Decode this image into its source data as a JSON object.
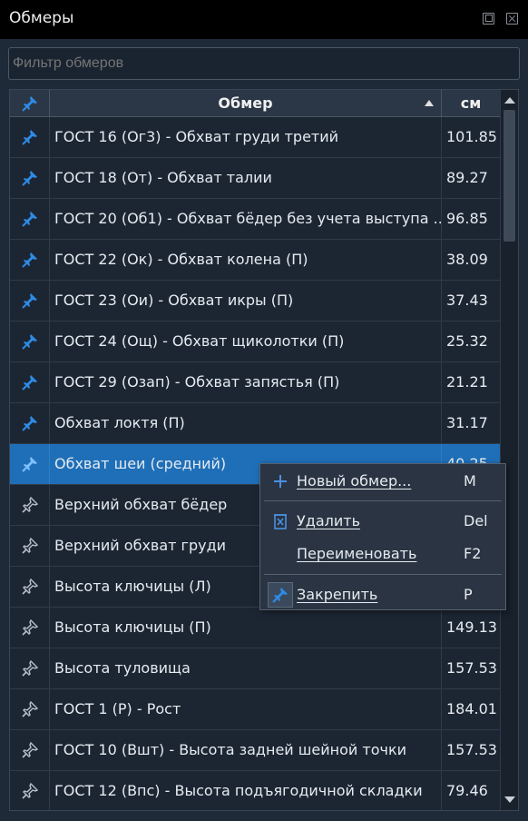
{
  "window": {
    "title": "Обмеры"
  },
  "filter": {
    "placeholder": "Фильтр обмеров"
  },
  "table": {
    "headers": {
      "name": "Обмер",
      "cm": "см"
    },
    "rows": [
      {
        "name": "ГОСТ 16 (Ог3) - Обхват груди третий",
        "cm": "101.85",
        "pinned": true
      },
      {
        "name": "ГОСТ 18 (От) - Обхват талии",
        "cm": "89.27",
        "pinned": true
      },
      {
        "name": "ГОСТ 20 (Об1) - Обхват бёдер без учета выступа ...",
        "cm": "96.85",
        "pinned": true
      },
      {
        "name": "ГОСТ 22 (Ок) - Обхват колена (П)",
        "cm": "38.09",
        "pinned": true
      },
      {
        "name": "ГОСТ 23 (Ои) - Обхват икры (П)",
        "cm": "37.43",
        "pinned": true
      },
      {
        "name": "ГОСТ 24 (Ощ) - Обхват щиколотки (П)",
        "cm": "25.32",
        "pinned": true
      },
      {
        "name": "ГОСТ 29 (Озап) - Обхват запястья (П)",
        "cm": "21.21",
        "pinned": true
      },
      {
        "name": "Обхват локтя (П)",
        "cm": "31.17",
        "pinned": true
      },
      {
        "name": "Обхват шеи (средний)",
        "cm": "40.25",
        "pinned": true,
        "selected": true
      },
      {
        "name": "Верхний обхват бёдер",
        "cm": "",
        "pinned": false
      },
      {
        "name": "Верхний обхват груди",
        "cm": "",
        "pinned": false
      },
      {
        "name": "Высота ключицы (Л)",
        "cm": "",
        "pinned": false
      },
      {
        "name": "Высота ключицы (П)",
        "cm": "149.13",
        "pinned": false
      },
      {
        "name": "Высота туловища",
        "cm": "157.53",
        "pinned": false
      },
      {
        "name": "ГОСТ 1 (Р) - Рост",
        "cm": "184.01",
        "pinned": false
      },
      {
        "name": "ГОСТ 10 (Вшт) - Высота задней шейной точки",
        "cm": "157.53",
        "pinned": false
      },
      {
        "name": "ГОСТ 12 (Впс) - Высота подъягодичной складки",
        "cm": "79.46",
        "pinned": false
      }
    ]
  },
  "context_menu": {
    "items": [
      {
        "label": "Новый обмер...",
        "shortcut": "M",
        "icon": "plus-icon"
      },
      {
        "label": "Удалить",
        "shortcut": "Del",
        "icon": "trash-icon"
      },
      {
        "label": "Переименовать",
        "shortcut": "F2",
        "icon": ""
      },
      {
        "label": "Закрепить",
        "shortcut": "P",
        "icon": "pin-icon"
      }
    ]
  },
  "colors": {
    "accent": "#1f6fb8",
    "pin_active": "#2e8be6",
    "background": "#1f2a38"
  }
}
